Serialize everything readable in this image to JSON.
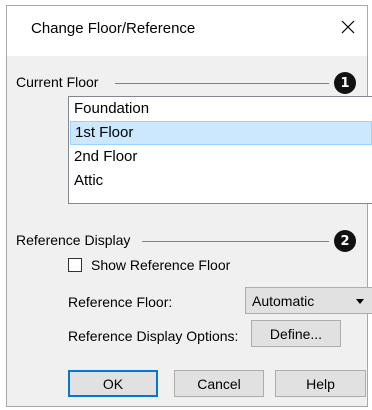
{
  "dialog": {
    "title": "Change Floor/Reference",
    "close_glyph": "×"
  },
  "current_floor": {
    "label": "Current Floor",
    "callout": "1",
    "items": [
      "Foundation",
      "1st Floor",
      "2nd Floor",
      "Attic"
    ],
    "selected_index": 1
  },
  "reference_display": {
    "label": "Reference Display",
    "callout": "2",
    "show_reference_floor_label": "Show Reference Floor",
    "show_reference_floor_checked": false,
    "reference_floor_label": "Reference Floor:",
    "reference_floor_value": "Automatic",
    "options_label": "Reference Display Options:",
    "define_button": "Define..."
  },
  "buttons": {
    "ok": "OK",
    "cancel": "Cancel",
    "help": "Help"
  },
  "colors": {
    "selection_bg": "#cce8ff",
    "default_button_border": "#0078d7"
  }
}
